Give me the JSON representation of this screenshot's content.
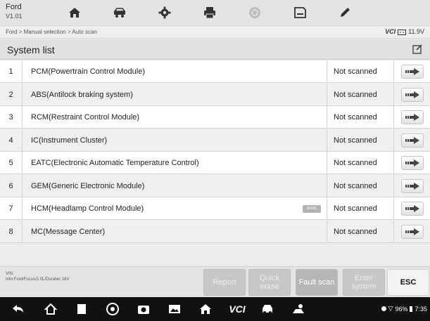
{
  "app": {
    "brand": "Ford",
    "version": "V1.01"
  },
  "toolbar": {
    "items": [
      {
        "icon": "home-icon"
      },
      {
        "icon": "vehicle-swap-icon"
      },
      {
        "icon": "settings-gear-icon"
      },
      {
        "icon": "print-icon"
      },
      {
        "icon": "help-icon"
      },
      {
        "icon": "save-icon"
      },
      {
        "icon": "edit-pen-icon"
      }
    ]
  },
  "breadcrumb": "Ford > Manual selection > Auto scan",
  "vci_status": {
    "label": "VCI",
    "voltage": "11.9V"
  },
  "section": {
    "title": "System list",
    "edit_icon": "edit-icon"
  },
  "systems": [
    {
      "index": "1",
      "name": "PCM(Powertrain Control Module)",
      "status": "Not scanned",
      "badge": ""
    },
    {
      "index": "2",
      "name": "ABS(Antilock braking system)",
      "status": "Not scanned",
      "badge": ""
    },
    {
      "index": "3",
      "name": "RCM(Restraint Control Module)",
      "status": "Not scanned",
      "badge": ""
    },
    {
      "index": "4",
      "name": "IC(Instrument Cluster)",
      "status": "Not scanned",
      "badge": ""
    },
    {
      "index": "5",
      "name": "EATC(Electronic Automatic Temperature Control)",
      "status": "Not scanned",
      "badge": ""
    },
    {
      "index": "6",
      "name": "GEM(Generic Electronic Module)",
      "status": "Not scanned",
      "badge": ""
    },
    {
      "index": "7",
      "name": "HCM(Headlamp Control Module)",
      "status": "Not scanned",
      "badge": "ADAS"
    },
    {
      "index": "8",
      "name": "MC(Message Center)",
      "status": "Not scanned",
      "badge": ""
    }
  ],
  "vehicle_info": {
    "vin": "VIN:",
    "info": "Info:Ford/Focus/2.0L/Duratec 16V"
  },
  "actions": {
    "report": "Report",
    "quick_erase": "Quick erase",
    "fault_scan": "Fault scan",
    "enter_system": "Enter system",
    "esc": "ESC"
  },
  "android_status": {
    "battery": "96%",
    "time": "7:35"
  },
  "colors": {
    "topbar": "#e4e4e4",
    "row_odd": "#ffffff",
    "row_even": "#f0f0f0",
    "nav_bar": "#111111",
    "disabled_button": "#c7c7c7"
  }
}
